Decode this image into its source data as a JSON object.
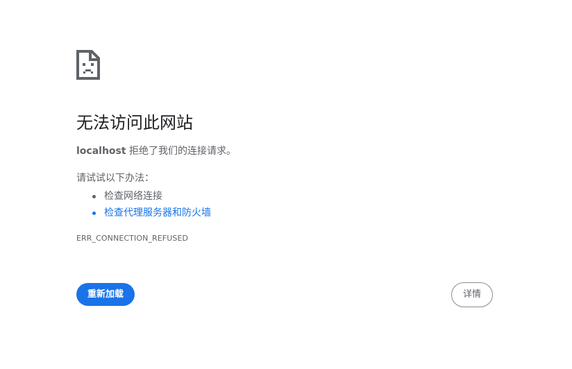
{
  "error_page": {
    "icon": "sad-page-icon",
    "title": "无法访问此网站",
    "host": "localhost",
    "message_suffix": " 拒绝了我们的连接请求。",
    "try_label": "请试试以下办法：",
    "suggestions": [
      {
        "label": "检查网络连接",
        "is_link": false
      },
      {
        "label": "检查代理服务器和防火墙",
        "is_link": true
      }
    ],
    "error_code": "ERR_CONNECTION_REFUSED",
    "reload_label": "重新加载",
    "details_label": "详情"
  },
  "colors": {
    "accent": "#1a73e8",
    "text_primary": "#202124",
    "text_secondary": "#5f6368"
  }
}
